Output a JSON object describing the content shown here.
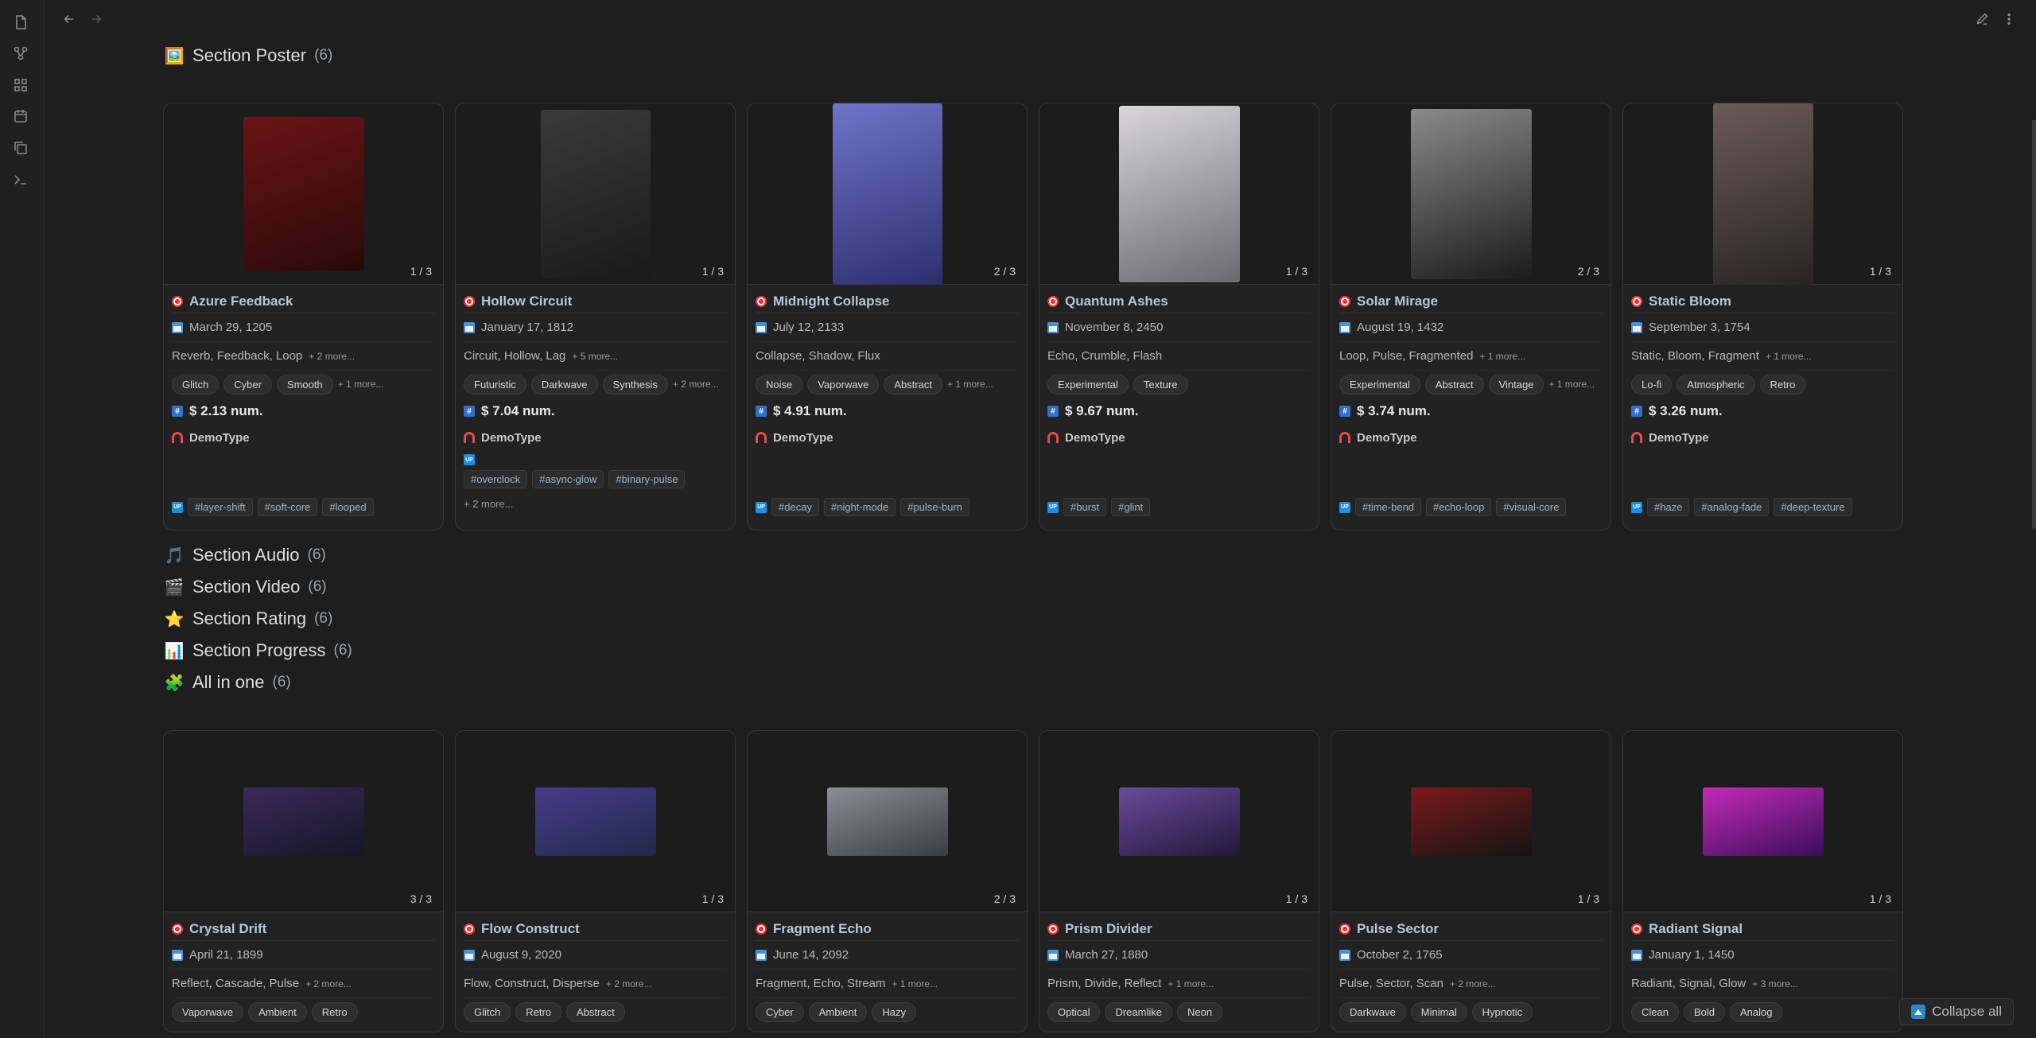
{
  "sections": {
    "poster": {
      "emoji": "🖼️",
      "title": "Section Poster",
      "count": "(6)"
    },
    "audio": {
      "emoji": "🎵",
      "title": "Section Audio",
      "count": "(6)"
    },
    "video": {
      "emoji": "🎬",
      "title": "Section Video",
      "count": "(6)"
    },
    "rating": {
      "emoji": "⭐",
      "title": "Section Rating",
      "count": "(6)"
    },
    "progress": {
      "emoji": "📊",
      "title": "Section Progress",
      "count": "(6)"
    },
    "allinone": {
      "emoji": "🧩",
      "title": "All in one",
      "count": "(6)"
    }
  },
  "poster_cards": [
    {
      "pager": "1 / 3",
      "title": "Azure Feedback",
      "date": "March 29, 1205",
      "words": "Reverb, Feedback, Loop",
      "words_more": "+ 2 more...",
      "chips": [
        "Glitch",
        "Cyber",
        "Smooth"
      ],
      "chips_more": "+ 1 more...",
      "price": "$ 2.13 num.",
      "owner": "DemoType",
      "tags": [
        "#layer-shift",
        "#soft-core",
        "#looped"
      ],
      "tags_more": "",
      "img_colors": [
        "#6b1414",
        "#2a0a0a"
      ]
    },
    {
      "pager": "1 / 3",
      "title": "Hollow Circuit",
      "date": "January 17, 1812",
      "words": "Circuit, Hollow, Lag",
      "words_more": "+ 5 more...",
      "chips": [
        "Futuristic",
        "Darkwave",
        "Synthesis"
      ],
      "chips_more": "+ 2 more...",
      "price": "$ 7.04 num.",
      "owner": "DemoType",
      "tags": [
        "#overclock",
        "#async-glow",
        "#binary-pulse"
      ],
      "tags_more": "+ 2 more...",
      "img_colors": [
        "#3a3a3a",
        "#1a1a1a"
      ]
    },
    {
      "pager": "2 / 3",
      "title": "Midnight Collapse",
      "date": "July 12, 2133",
      "words": "Collapse, Shadow, Flux",
      "words_more": "",
      "chips": [
        "Noise",
        "Vaporwave",
        "Abstract"
      ],
      "chips_more": "+ 1 more...",
      "price": "$ 4.91 num.",
      "owner": "DemoType",
      "tags": [
        "#decay",
        "#night-mode",
        "#pulse-burn"
      ],
      "tags_more": "",
      "img_colors": [
        "#6f74c9",
        "#2c2f6e"
      ]
    },
    {
      "pager": "1 / 3",
      "title": "Quantum Ashes",
      "date": "November 8, 2450",
      "words": "Echo, Crumble, Flash",
      "words_more": "",
      "chips": [
        "Experimental",
        "Texture"
      ],
      "chips_more": "",
      "price": "$ 9.67 num.",
      "owner": "DemoType",
      "tags": [
        "#burst",
        "#glint"
      ],
      "tags_more": "",
      "img_colors": [
        "#d8d6da",
        "#6a6a70"
      ]
    },
    {
      "pager": "2 / 3",
      "title": "Solar Mirage",
      "date": "August 19, 1432",
      "words": "Loop, Pulse, Fragmented",
      "words_more": "+ 1 more...",
      "chips": [
        "Experimental",
        "Abstract",
        "Vintage"
      ],
      "chips_more": "+ 1 more...",
      "price": "$ 3.74 num.",
      "owner": "DemoType",
      "tags": [
        "#time-bend",
        "#echo-loop",
        "#visual-core"
      ],
      "tags_more": "",
      "img_colors": [
        "#8a8a8a",
        "#1b1b1b"
      ]
    },
    {
      "pager": "1 / 3",
      "title": "Static Bloom",
      "date": "September 3, 1754",
      "words": "Static, Bloom, Fragment",
      "words_more": "+ 1 more...",
      "chips": [
        "Lo-fi",
        "Atmospheric",
        "Retro"
      ],
      "chips_more": "",
      "price": "$ 3.26 num.",
      "owner": "DemoType",
      "tags": [
        "#haze",
        "#analog-fade",
        "#deep-texture"
      ],
      "tags_more": "",
      "img_colors": [
        "#6a5a5a",
        "#2a2424"
      ]
    }
  ],
  "allinone_cards": [
    {
      "pager": "3 / 3",
      "title": "Crystal Drift",
      "date": "April 21, 1899",
      "words": "Reflect, Cascade, Pulse",
      "words_more": "+ 2 more...",
      "chips": [
        "Vaporwave",
        "Ambient",
        "Retro"
      ],
      "img_colors": [
        "#3b2a5a",
        "#141626"
      ]
    },
    {
      "pager": "1 / 3",
      "title": "Flow Construct",
      "date": "August 9, 2020",
      "words": "Flow, Construct, Disperse",
      "words_more": "+ 2 more...",
      "chips": [
        "Glitch",
        "Retro",
        "Abstract"
      ],
      "img_colors": [
        "#4a3b8a",
        "#1e2a4a"
      ]
    },
    {
      "pager": "2 / 3",
      "title": "Fragment Echo",
      "date": "June 14, 2092",
      "words": "Fragment, Echo, Stream",
      "words_more": "+ 1 more...",
      "chips": [
        "Cyber",
        "Ambient",
        "Hazy"
      ],
      "img_colors": [
        "#8a8e94",
        "#3a3d42"
      ]
    },
    {
      "pager": "1 / 3",
      "title": "Prism Divider",
      "date": "March 27, 1880",
      "words": "Prism, Divide, Reflect",
      "words_more": "+ 1 more...",
      "chips": [
        "Optical",
        "Dreamlike",
        "Neon"
      ],
      "img_colors": [
        "#6a4a9a",
        "#22183a"
      ]
    },
    {
      "pager": "1 / 3",
      "title": "Pulse Sector",
      "date": "October 2, 1765",
      "words": "Pulse, Sector, Scan",
      "words_more": "+ 2 more...",
      "chips": [
        "Darkwave",
        "Minimal",
        "Hypnotic"
      ],
      "img_colors": [
        "#7a1a1a",
        "#141414"
      ]
    },
    {
      "pager": "1 / 3",
      "title": "Radiant Signal",
      "date": "January 1, 1450",
      "words": "Radiant, Signal, Glow",
      "words_more": "+ 3 more...",
      "chips": [
        "Clean",
        "Bold",
        "Analog"
      ],
      "img_colors": [
        "#c42ab8",
        "#3a0e5a"
      ]
    }
  ],
  "collapse_label": "Collapse all",
  "icons": {
    "ribbon": [
      "file-icon",
      "graph-icon",
      "grid-icon",
      "calendar-icon",
      "copy-icon",
      "terminal-icon"
    ],
    "nav": [
      "back-arrow-icon",
      "forward-arrow-icon"
    ],
    "topright": [
      "edit-icon",
      "more-vertical-icon"
    ]
  }
}
